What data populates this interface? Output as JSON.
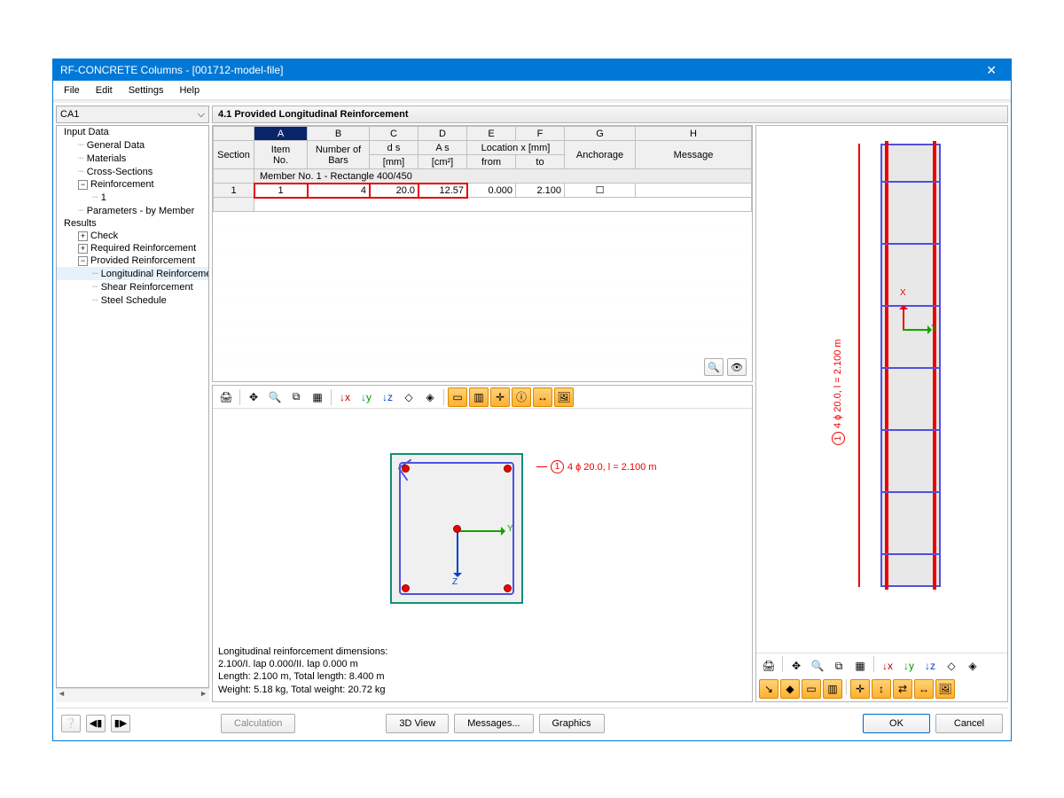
{
  "window": {
    "title": "RF-CONCRETE Columns - [001712-model-file]"
  },
  "menu": {
    "file": "File",
    "edit": "Edit",
    "settings": "Settings",
    "help": "Help"
  },
  "combo": {
    "value": "CA1"
  },
  "tree": {
    "input_data": "Input Data",
    "general_data": "General Data",
    "materials": "Materials",
    "cross_sections": "Cross-Sections",
    "reinforcement": "Reinforcement",
    "reinforcement_1": "1",
    "parameters": "Parameters - by Member",
    "results": "Results",
    "check": "Check",
    "required": "Required Reinforcement",
    "provided": "Provided Reinforcement",
    "longitudinal": "Longitudinal Reinforcement",
    "shear": "Shear Reinforcement",
    "steel": "Steel Schedule"
  },
  "panel": {
    "title": "4.1 Provided Longitudinal Reinforcement"
  },
  "grid": {
    "letters": [
      "A",
      "B",
      "C",
      "D",
      "E",
      "F",
      "G",
      "H"
    ],
    "h_section": "Section",
    "h_item": "Item\nNo.",
    "h_numbars": "Number of\nBars",
    "h_ds_top": "d s",
    "h_ds_bot": "[mm]",
    "h_as_top": "A s",
    "h_as_bot": "[cm²]",
    "h_loc": "Location x [mm]",
    "h_from": "from",
    "h_to": "to",
    "h_anch": "Anchorage",
    "h_msg": "Message",
    "group": "Member No. 1 - Rectangle 400/450",
    "row1": {
      "sec": "1",
      "item": "1",
      "bars": "4",
      "ds": "20.0",
      "as": "12.57",
      "from": "0.000",
      "to": "2.100",
      "anch": "☐",
      "msg": ""
    }
  },
  "viewer": {
    "callout": "4 ɸ 20.0, l = 2.100 m",
    "y": "Y",
    "z": "Z",
    "x": "X",
    "text1": "Longitudinal reinforcement dimensions:",
    "text2": "2.100/I. lap 0.000/II. lap 0.000 m",
    "text3": "Length: 2.100 m, Total length: 8.400 m",
    "text4": "Weight: 5.18 kg, Total weight: 20.72 kg"
  },
  "buttons": {
    "calc": "Calculation",
    "view3d": "3D View",
    "messages": "Messages...",
    "graphics": "Graphics",
    "ok": "OK",
    "cancel": "Cancel"
  }
}
